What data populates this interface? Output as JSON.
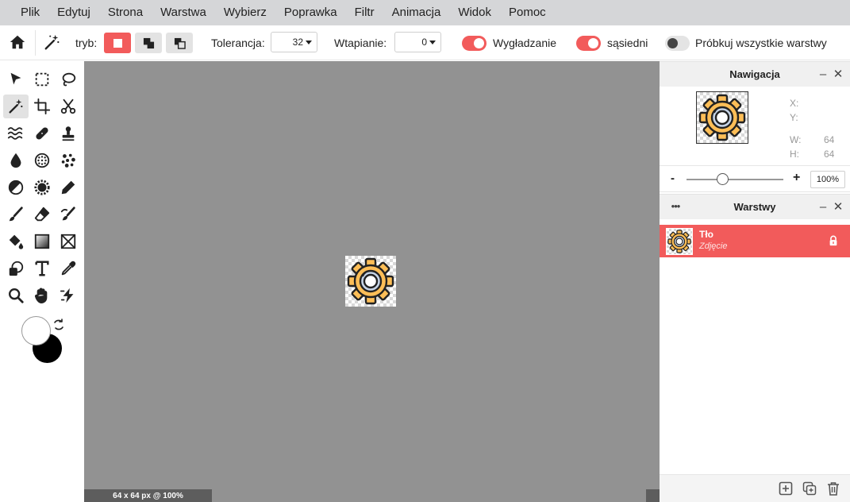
{
  "menu": [
    "Plik",
    "Edytuj",
    "Strona",
    "Warstwa",
    "Wybierz",
    "Poprawka",
    "Filtr",
    "Animacja",
    "Widok",
    "Pomoc"
  ],
  "toolbar": {
    "mode_label": "tryb:",
    "tolerance_label": "Tolerancja:",
    "tolerance_value": "32",
    "feather_label": "Wtapianie:",
    "feather_value": "0",
    "antialias_label": "Wygładzanie",
    "antialias_on": true,
    "contiguous_label": "sąsiedni",
    "contiguous_on": true,
    "sample_all_label": "Próbkuj wszystkie warstwy",
    "sample_all_on": false,
    "accent_color": "#f25b5b"
  },
  "tools": [
    "select-arrow-icon",
    "marquee-select-icon",
    "lasso-icon",
    "magic-wand-icon",
    "crop-icon",
    "scissors-icon",
    "liquify-icon",
    "healing-bandage-icon",
    "clone-stamp-icon",
    "blur-drop-icon",
    "sponge-icon",
    "spot-pattern-icon",
    "dodge-burn-icon",
    "sharpen-gear-icon",
    "pencil-icon",
    "brush-icon",
    "eraser-icon",
    "smudge-brush-icon",
    "paint-bucket-icon",
    "gradient-icon",
    "frame-icon",
    "shape-icon",
    "text-icon",
    "eyedropper-icon",
    "zoom-icon",
    "hand-icon",
    "quick-action-icon"
  ],
  "active_tool": "magic-wand-icon",
  "colors": {
    "primary": "#ffffff",
    "secondary": "#000000"
  },
  "canvas": {
    "status": "64 x 64 px @ 100%",
    "background": "#929292"
  },
  "navigation": {
    "title": "Nawigacja",
    "x_label": "X:",
    "x_value": "",
    "y_label": "Y:",
    "y_value": "",
    "w_label": "W:",
    "w_value": "64",
    "h_label": "H:",
    "h_value": "64",
    "zoom_minus": "-",
    "zoom_plus": "+",
    "zoom_value": "100%"
  },
  "layers": {
    "title": "Warstwy",
    "menu_label": "•••",
    "items": [
      {
        "name": "Tło",
        "type": "Zdjęcie",
        "locked": true
      }
    ]
  }
}
